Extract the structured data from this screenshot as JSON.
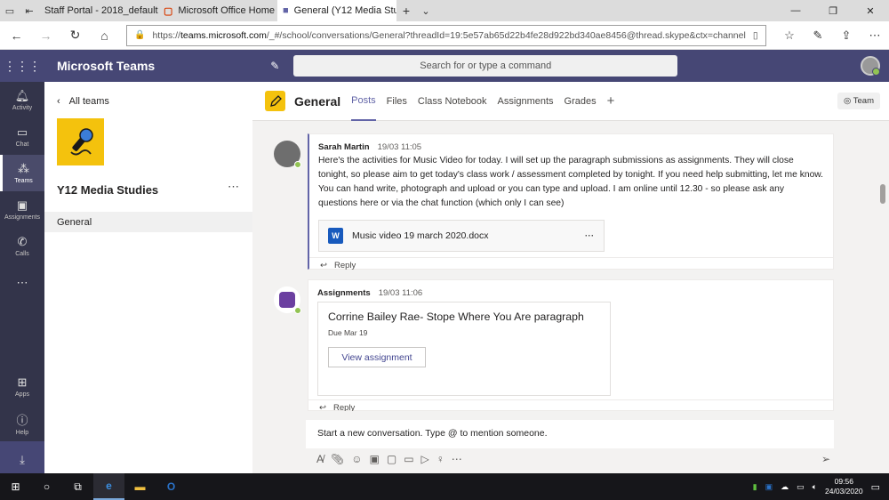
{
  "browser": {
    "tabs": [
      {
        "title": "Staff Portal - 2018_default"
      },
      {
        "title": "Microsoft Office Home"
      },
      {
        "title": "General (Y12 Media Stu"
      }
    ],
    "url_scheme": "https://",
    "url_host": "teams.microsoft.com",
    "url_rest": "/_#/school/conversations/General?threadId=19:5e57ab65d22b4fe28d922bd340ae8456@thread.skype&ctx=channel"
  },
  "teams_header": {
    "app_title": "Microsoft Teams",
    "search_placeholder": "Search for or type a command"
  },
  "rail": {
    "items": [
      {
        "label": "Activity",
        "icon": "bell-icon"
      },
      {
        "label": "Chat",
        "icon": "chat-icon"
      },
      {
        "label": "Teams",
        "icon": "teams-icon"
      },
      {
        "label": "Assignments",
        "icon": "assignments-icon"
      },
      {
        "label": "Calls",
        "icon": "phone-icon"
      }
    ],
    "bottom": [
      {
        "label": "Apps",
        "icon": "apps-icon"
      },
      {
        "label": "Help",
        "icon": "help-icon"
      }
    ]
  },
  "team_panel": {
    "back_label": "All teams",
    "team_name": "Y12 Media Studies",
    "channel": "General"
  },
  "channel_header": {
    "title": "General",
    "tabs": [
      "Posts",
      "Files",
      "Class Notebook",
      "Assignments",
      "Grades"
    ],
    "active_tab": "Posts",
    "team_button": "Team"
  },
  "messages": [
    {
      "sender": "Sarah Martin",
      "timestamp": "19/03 11:05",
      "body": "Here's the  activities for Music Video for today.  I will set up the paragraph submissions as assignments.  They will close tonight, so please aim to get today's class work / assessment completed by tonight.  If you need help submitting, let me know.  You can hand write, photograph and upload or you can type and upload. I am online until 12.30 - so please ask any questions here or via the chat function (which only I can see)",
      "attachment": "Music video 19 march 2020.docx",
      "reply_label": "Reply"
    },
    {
      "sender": "Assignments",
      "timestamp": "19/03 11:06",
      "assignment_title": "Corrine Bailey Rae- Stope Where You Are paragraph",
      "due": "Due Mar 19",
      "button": "View assignment",
      "reply_label": "Reply"
    }
  ],
  "compose": {
    "placeholder": "Start a new conversation. Type @ to mention someone."
  },
  "taskbar": {
    "time": "09:56",
    "date": "24/03/2020"
  },
  "colors": {
    "teams_purple": "#464775",
    "rail_dark": "#33344a",
    "accent": "#6264a7",
    "team_yellow": "#f4c20d",
    "presence_green": "#92c353"
  }
}
